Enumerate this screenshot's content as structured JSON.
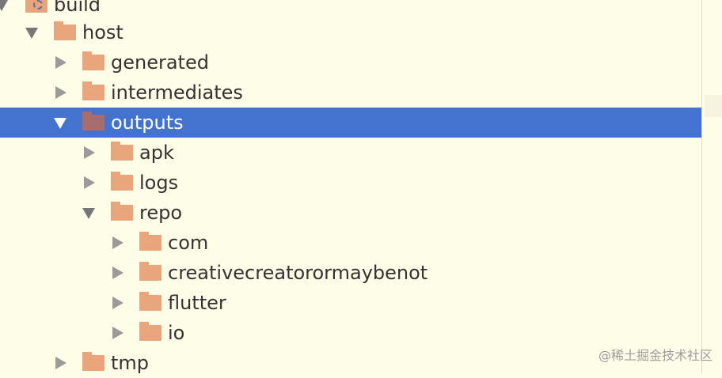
{
  "tree": {
    "items": [
      {
        "label": "build",
        "expanded": true,
        "icon": "gear-folder-icon",
        "selected": false
      },
      {
        "label": "host",
        "expanded": true,
        "icon": "folder-icon",
        "selected": false
      },
      {
        "label": "generated",
        "expanded": false,
        "icon": "folder-icon",
        "selected": false
      },
      {
        "label": "intermediates",
        "expanded": false,
        "icon": "folder-icon",
        "selected": false
      },
      {
        "label": "outputs",
        "expanded": true,
        "icon": "folder-icon",
        "selected": true
      },
      {
        "label": "apk",
        "expanded": false,
        "icon": "folder-icon",
        "selected": false
      },
      {
        "label": "logs",
        "expanded": false,
        "icon": "folder-icon",
        "selected": false
      },
      {
        "label": "repo",
        "expanded": true,
        "icon": "folder-icon",
        "selected": false
      },
      {
        "label": "com",
        "expanded": false,
        "icon": "folder-icon",
        "selected": false
      },
      {
        "label": "creativecreatorormaybenot",
        "expanded": false,
        "icon": "folder-icon",
        "selected": false
      },
      {
        "label": "flutter",
        "expanded": false,
        "icon": "folder-icon",
        "selected": false
      },
      {
        "label": "io",
        "expanded": false,
        "icon": "folder-icon",
        "selected": false
      },
      {
        "label": "tmp",
        "expanded": false,
        "icon": "folder-icon",
        "selected": false
      }
    ]
  },
  "watermark": "@稀土掘金技术社区",
  "colors": {
    "background": "#fefde8",
    "selection": "#4472cf",
    "folder": "#e9a47b",
    "text": "#333333"
  }
}
